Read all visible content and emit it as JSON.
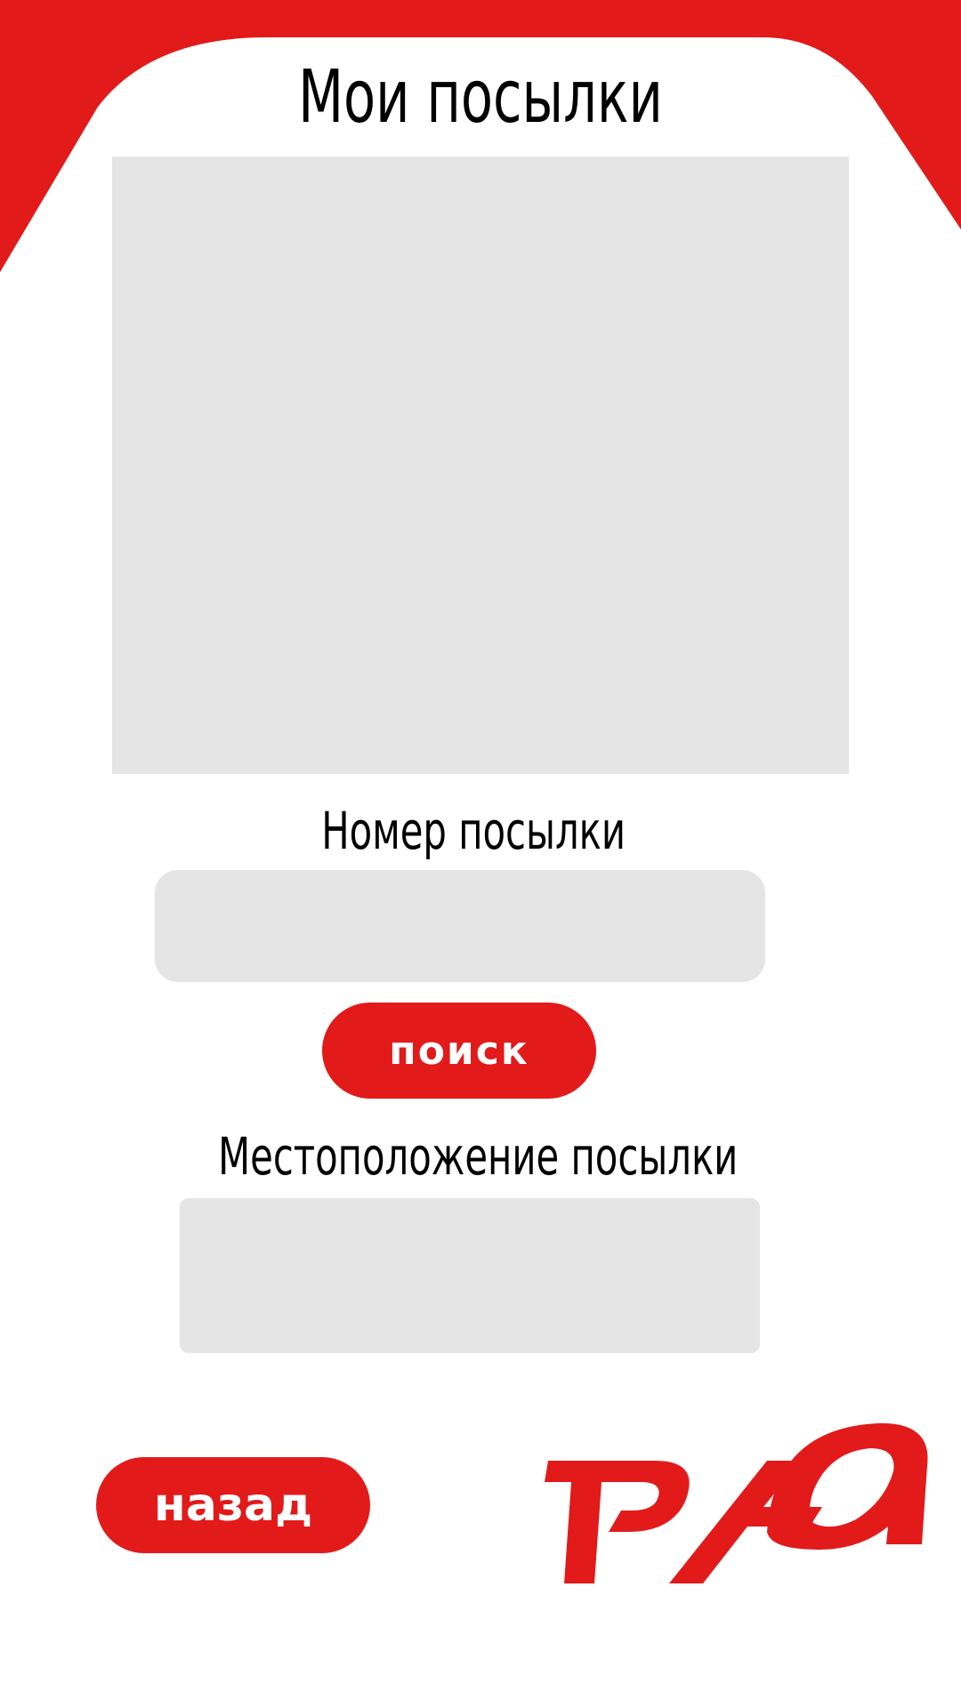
{
  "app": {
    "title": "Мои посылки"
  },
  "colors": {
    "brand_red": "#e21a1a",
    "field_gray": "#e5e5e5",
    "background": "#ffffff"
  },
  "parcel_form": {
    "number_label": "Номер посылки",
    "number_value": "",
    "search_label": "поиск",
    "location_label": "Местоположение посылки",
    "location_value": ""
  },
  "footer": {
    "back_label": "назад",
    "logo": "rzd-logo"
  }
}
